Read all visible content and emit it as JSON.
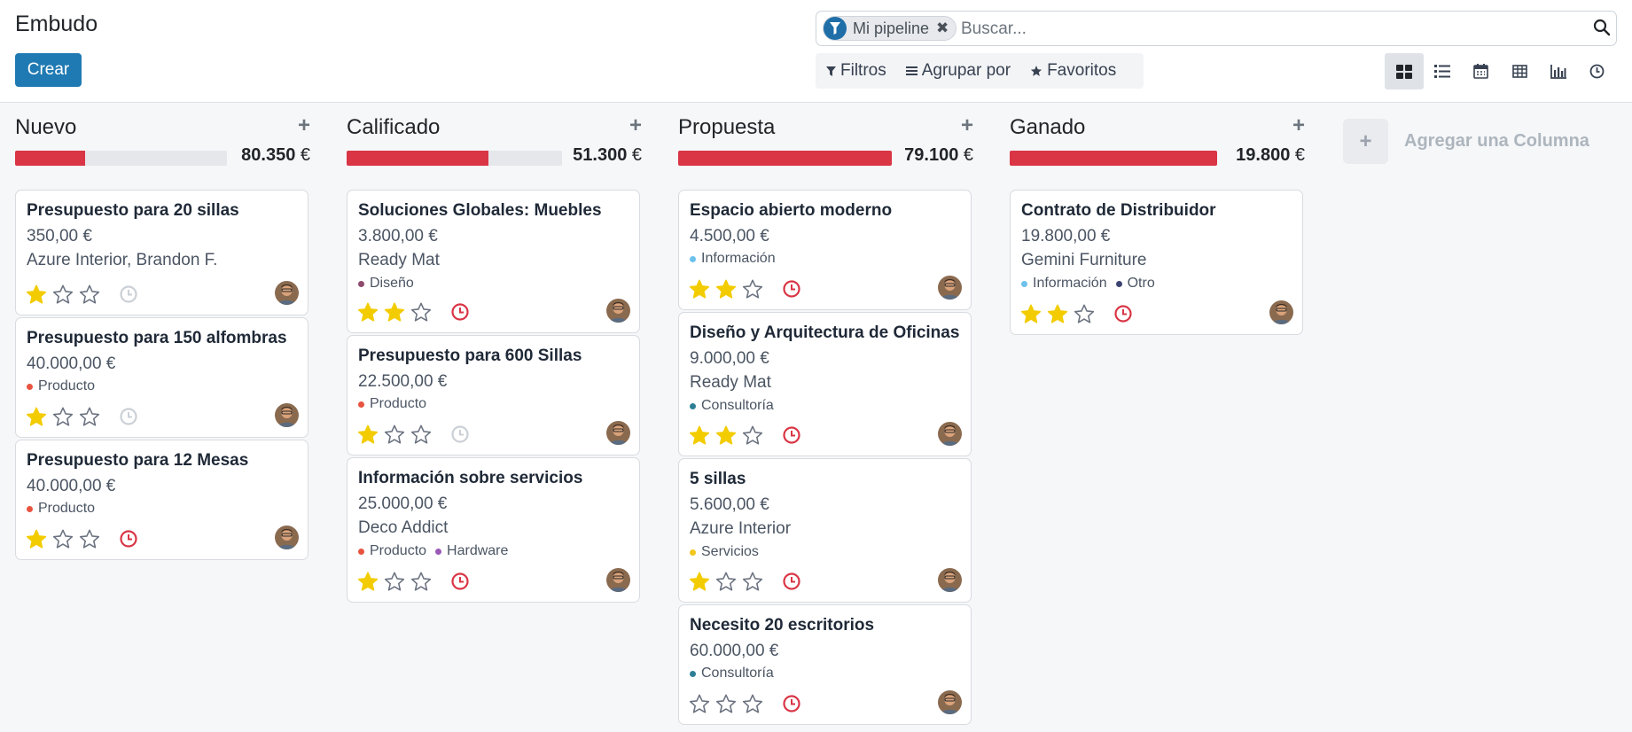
{
  "page": {
    "title": "Embudo",
    "create_label": "Crear"
  },
  "search": {
    "facet_label": "Mi pipeline",
    "facet_remove": "✖",
    "placeholder": "Buscar..."
  },
  "filters": {
    "filters_label": "Filtros",
    "groupby_label": "Agrupar por",
    "favorites_label": "Favoritos"
  },
  "views": [
    "kanban-icon",
    "list-icon",
    "calendar-icon",
    "pivot-icon",
    "graph-icon",
    "activity-icon"
  ],
  "colors": {
    "accent": "#1f7ab3",
    "progress_red": "#d93545",
    "star_gold": "#f3cc00"
  },
  "columns": [
    {
      "name": "Nuevo",
      "total": "80.350",
      "currency": "€",
      "progress_pct": 33,
      "cards": [
        {
          "title": "Presupuesto para 20 sillas",
          "amount": "350,00 €",
          "partner": "Azure Interior, Brandon F.",
          "tags": [],
          "stars": 1,
          "activity": "none"
        },
        {
          "title": "Presupuesto para 150 alfombras",
          "amount": "40.000,00 €",
          "partner": "",
          "tags": [
            {
              "label": "Producto",
              "color": "#e8533f"
            }
          ],
          "stars": 1,
          "activity": "none"
        },
        {
          "title": "Presupuesto para 12 Mesas",
          "amount": "40.000,00 €",
          "partner": "",
          "tags": [
            {
              "label": "Producto",
              "color": "#e8533f"
            }
          ],
          "stars": 1,
          "activity": "overdue"
        }
      ]
    },
    {
      "name": "Calificado",
      "total": "51.300",
      "currency": "€",
      "progress_pct": 66,
      "cards": [
        {
          "title": "Soluciones Globales: Muebles",
          "amount": "3.800,00 €",
          "partner": "Ready Mat",
          "tags": [
            {
              "label": "Diseño",
              "color": "#8e4b6d"
            }
          ],
          "stars": 2,
          "activity": "overdue"
        },
        {
          "title": "Presupuesto para 600 Sillas",
          "amount": "22.500,00 €",
          "partner": "",
          "tags": [
            {
              "label": "Producto",
              "color": "#e8533f"
            }
          ],
          "stars": 1,
          "activity": "none"
        },
        {
          "title": "Información sobre servicios",
          "amount": "25.000,00 €",
          "partner": "Deco Addict",
          "tags": [
            {
              "label": "Producto",
              "color": "#e8533f"
            },
            {
              "label": "Hardware",
              "color": "#9b59b6"
            }
          ],
          "stars": 1,
          "activity": "overdue"
        }
      ]
    },
    {
      "name": "Propuesta",
      "total": "79.100",
      "currency": "€",
      "progress_pct": 100,
      "cards": [
        {
          "title": "Espacio abierto moderno",
          "amount": "4.500,00 €",
          "partner": "",
          "tags": [
            {
              "label": "Información",
              "color": "#6cc1ed"
            }
          ],
          "stars": 2,
          "activity": "overdue"
        },
        {
          "title": "Diseño y Arquitectura de Oficinas",
          "amount": "9.000,00 €",
          "partner": "Ready Mat",
          "tags": [
            {
              "label": "Consultoría",
              "color": "#2e7f95"
            }
          ],
          "stars": 2,
          "activity": "overdue"
        },
        {
          "title": "5 sillas",
          "amount": "5.600,00 €",
          "partner": "Azure Interior",
          "tags": [
            {
              "label": "Servicios",
              "color": "#f4c61c"
            }
          ],
          "stars": 1,
          "activity": "overdue"
        },
        {
          "title": "Necesito 20 escritorios",
          "amount": "60.000,00 €",
          "partner": "",
          "tags": [
            {
              "label": "Consultoría",
              "color": "#2e7f95"
            }
          ],
          "stars": 0,
          "activity": "overdue"
        }
      ]
    },
    {
      "name": "Ganado",
      "total": "19.800",
      "currency": "€",
      "progress_pct": 100,
      "cards": [
        {
          "title": "Contrato de Distribuidor",
          "amount": "19.800,00 €",
          "partner": "Gemini Furniture",
          "tags": [
            {
              "label": "Información",
              "color": "#6cc1ed"
            },
            {
              "label": "Otro",
              "color": "#3c4470"
            }
          ],
          "stars": 2,
          "activity": "overdue"
        }
      ]
    }
  ],
  "add_column": {
    "label": "Agregar una Columna",
    "plus": "+"
  }
}
